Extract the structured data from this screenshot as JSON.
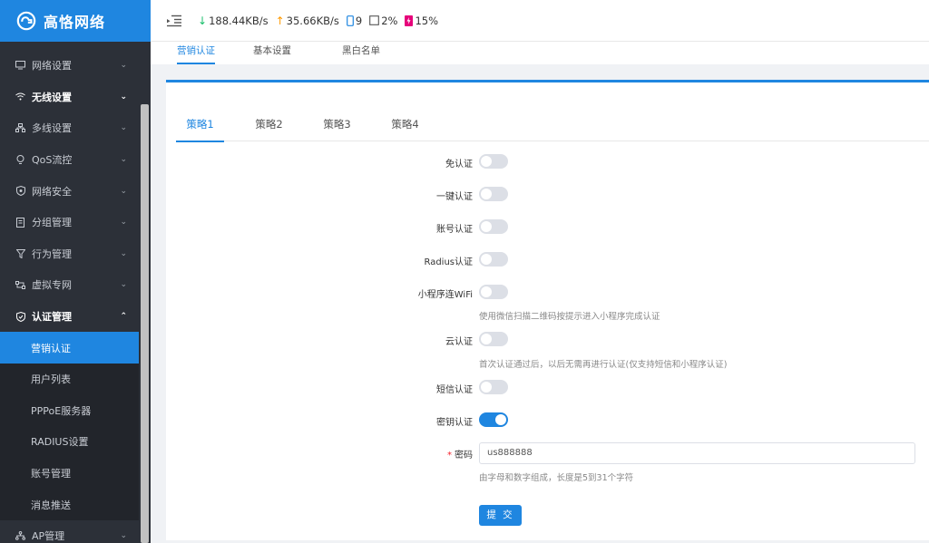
{
  "app": {
    "title": "高恪网络"
  },
  "topbar": {
    "download": "188.44KB/s",
    "upload": "35.66KB/s",
    "devices": "9",
    "cpu": "2%",
    "memory": "15%"
  },
  "sidebar": {
    "items": [
      {
        "label": "网络设置",
        "icon": "monitor-icon"
      },
      {
        "label": "无线设置",
        "icon": "wifi-icon"
      },
      {
        "label": "多线设置",
        "icon": "network-icon"
      },
      {
        "label": "QoS流控",
        "icon": "bulb-icon"
      },
      {
        "label": "网络安全",
        "icon": "shield-icon"
      },
      {
        "label": "分组管理",
        "icon": "document-icon"
      },
      {
        "label": "行为管理",
        "icon": "filter-icon"
      },
      {
        "label": "虚拟专网",
        "icon": "vpn-icon"
      },
      {
        "label": "认证管理",
        "icon": "shield-check-icon"
      }
    ],
    "subitems": [
      {
        "label": "营销认证"
      },
      {
        "label": "用户列表"
      },
      {
        "label": "PPPoE服务器"
      },
      {
        "label": "RADIUS设置"
      },
      {
        "label": "账号管理"
      },
      {
        "label": "消息推送"
      }
    ],
    "more": {
      "label": "AP管理",
      "icon": "sitemap-icon"
    }
  },
  "page_tabs": [
    {
      "label": "营销认证"
    },
    {
      "label": "基本设置"
    },
    {
      "label": "黑白名单"
    }
  ],
  "strategy_tabs": [
    {
      "label": "策略1"
    },
    {
      "label": "策略2"
    },
    {
      "label": "策略3"
    },
    {
      "label": "策略4"
    }
  ],
  "form": {
    "free_auth": {
      "label": "免认证",
      "enabled": false
    },
    "one_click": {
      "label": "一键认证",
      "enabled": false
    },
    "account": {
      "label": "账号认证",
      "enabled": false
    },
    "radius": {
      "label": "Radius认证",
      "enabled": false
    },
    "miniprogram": {
      "label": "小程序连WiFi",
      "enabled": false,
      "hint": "使用微信扫描二维码按提示进入小程序完成认证"
    },
    "cloud": {
      "label": "云认证",
      "enabled": false,
      "hint": "首次认证通过后，以后无需再进行认证(仅支持短信和小程序认证)"
    },
    "sms": {
      "label": "短信认证",
      "enabled": false
    },
    "key": {
      "label": "密钥认证",
      "enabled": true
    },
    "password": {
      "label": "密码",
      "required_mark": "*",
      "value": "us888888",
      "hint": "由字母和数字组成，长度是5到31个字符"
    },
    "submit_label": "提 交"
  },
  "colors": {
    "accent": "#1f86e0",
    "sidebar_bg": "#2c3038",
    "download": "#19be6b",
    "upload": "#ff9900",
    "memory": "#e6007a"
  }
}
